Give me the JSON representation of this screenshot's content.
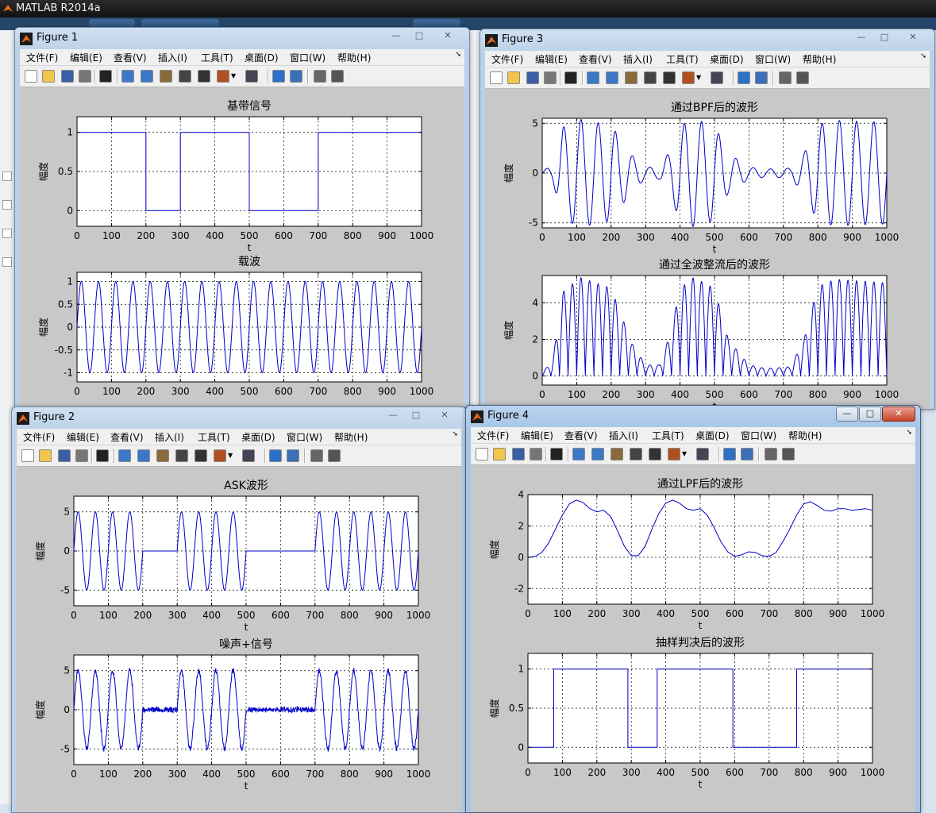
{
  "app": {
    "title": "MATLAB R2014a"
  },
  "colors": {
    "line": "#0000cc",
    "axes_bg": "#ffffff",
    "figure_bg": "#c8c8c8",
    "grid": "#000000"
  },
  "figures": [
    {
      "id": "fig1",
      "title": "Figure 1",
      "win_buttons": [
        "—",
        "□",
        "✕"
      ],
      "menu": [
        "文件(F)",
        "编辑(E)",
        "查看(V)",
        "插入(I)",
        "工具(T)",
        "桌面(D)",
        "窗口(W)",
        "帮助(H)"
      ]
    },
    {
      "id": "fig3",
      "title": "Figure 3",
      "win_buttons": [
        "—",
        "□",
        "✕"
      ],
      "menu": [
        "文件(F)",
        "编辑(E)",
        "查看(V)",
        "插入(I)",
        "工具(T)",
        "桌面(D)",
        "窗口(W)",
        "帮助(H)"
      ]
    },
    {
      "id": "fig2",
      "title": "Figure 2",
      "win_buttons": [
        "—",
        "□",
        "✕"
      ],
      "menu": [
        "文件(F)",
        "编辑(E)",
        "查看(V)",
        "插入(I)",
        "工具(T)",
        "桌面(D)",
        "窗口(W)",
        "帮助(H)"
      ]
    },
    {
      "id": "fig4",
      "title": "Figure 4",
      "win_buttons": [
        "—",
        "□",
        "✕"
      ],
      "menu": [
        "文件(F)",
        "编辑(E)",
        "查看(V)",
        "插入(I)",
        "工具(T)",
        "桌面(D)",
        "窗口(W)",
        "帮助(H)"
      ]
    }
  ],
  "toolbar_icons": [
    "new-file-icon",
    "open-folder-icon",
    "save-icon",
    "print-icon",
    "pointer-icon",
    "zoom-in-icon",
    "zoom-out-icon",
    "pan-hand-icon",
    "rotate-3d-icon",
    "data-cursor-icon",
    "brush-icon",
    "brush-dropdown-icon",
    "link-plot-icon",
    "colorbar-icon",
    "legend-icon",
    "hide-plot-tools-icon",
    "show-plot-tools-icon"
  ],
  "chart_data": [
    {
      "id": "baseband",
      "type": "line",
      "title": "基带信号",
      "xlabel": "t",
      "ylabel": "幅度",
      "xlim": [
        0,
        1000
      ],
      "ylim": [
        -0.2,
        1.2
      ],
      "xticks": [
        0,
        100,
        200,
        300,
        400,
        500,
        600,
        700,
        800,
        900,
        1000
      ],
      "yticks": [
        0,
        0.5,
        1
      ],
      "ytick_labels": [
        "0",
        "0.5",
        "1"
      ],
      "grid": true,
      "x": [
        0,
        200,
        200,
        300,
        300,
        500,
        500,
        700,
        700,
        1000
      ],
      "y": [
        1,
        1,
        0,
        0,
        1,
        1,
        0,
        0,
        1,
        1
      ]
    },
    {
      "id": "carrier",
      "type": "line",
      "title": "载波",
      "xlabel": "",
      "ylabel": "幅度",
      "xlim": [
        0,
        1000
      ],
      "ylim": [
        -1.2,
        1.2
      ],
      "xticks": [
        0,
        100,
        200,
        300,
        400,
        500,
        600,
        700,
        800,
        900,
        1000
      ],
      "yticks": [
        -1,
        -0.5,
        0,
        0.5,
        1
      ],
      "ytick_labels": [
        "-1",
        "-0.5",
        "0",
        "0.5",
        "1"
      ],
      "grid": true,
      "series": [
        {
          "function": "sin",
          "amplitude": 1,
          "period": 50,
          "phase": 0
        }
      ]
    },
    {
      "id": "bpf",
      "type": "line",
      "title": "通过BPF后的波形",
      "xlabel": "t",
      "ylabel": "幅度",
      "xlim": [
        0,
        1000
      ],
      "ylim": [
        -5.5,
        5.5
      ],
      "xticks": [
        0,
        100,
        200,
        300,
        400,
        500,
        600,
        700,
        800,
        900,
        1000
      ],
      "yticks": [
        -5,
        0,
        5
      ],
      "ytick_labels": [
        "-5",
        "0",
        "5"
      ],
      "grid": true,
      "series": [
        {
          "function": "sin",
          "period": 50,
          "envelope": [
            [
              0,
              0.2
            ],
            [
              30,
              0.8
            ],
            [
              60,
              4.6
            ],
            [
              110,
              5.4
            ],
            [
              200,
              4.8
            ],
            [
              260,
              1.8
            ],
            [
              300,
              0.6
            ],
            [
              340,
              0.6
            ],
            [
              370,
              2.2
            ],
            [
              400,
              4.8
            ],
            [
              440,
              5.4
            ],
            [
              500,
              4.8
            ],
            [
              540,
              2.0
            ],
            [
              600,
              0.6
            ],
            [
              650,
              0.4
            ],
            [
              720,
              0.5
            ],
            [
              760,
              2.0
            ],
            [
              800,
              4.9
            ],
            [
              850,
              5.3
            ],
            [
              1000,
              5.1
            ]
          ]
        }
      ]
    },
    {
      "id": "rectified",
      "type": "line",
      "title": "通过全波整流后的波形",
      "xlabel": "t",
      "ylabel": "幅度",
      "xlim": [
        0,
        1000
      ],
      "ylim": [
        -0.5,
        5.5
      ],
      "xticks": [
        0,
        100,
        200,
        300,
        400,
        500,
        600,
        700,
        800,
        900,
        1000
      ],
      "yticks": [
        0,
        2,
        4
      ],
      "ytick_labels": [
        "0",
        "2",
        "4"
      ],
      "grid": true,
      "series": [
        {
          "function": "abs-sin",
          "period": 50,
          "envelope": [
            [
              0,
              0.2
            ],
            [
              30,
              0.8
            ],
            [
              60,
              4.6
            ],
            [
              110,
              5.4
            ],
            [
              200,
              4.8
            ],
            [
              260,
              1.8
            ],
            [
              300,
              0.6
            ],
            [
              340,
              0.6
            ],
            [
              370,
              2.2
            ],
            [
              400,
              4.8
            ],
            [
              440,
              5.4
            ],
            [
              500,
              4.8
            ],
            [
              540,
              2.0
            ],
            [
              600,
              0.6
            ],
            [
              650,
              0.4
            ],
            [
              720,
              0.5
            ],
            [
              760,
              2.0
            ],
            [
              800,
              4.9
            ],
            [
              850,
              5.3
            ],
            [
              1000,
              5.1
            ]
          ]
        }
      ]
    },
    {
      "id": "ask",
      "type": "line",
      "title": "ASK波形",
      "xlabel": "t",
      "ylabel": "幅度",
      "xlim": [
        0,
        1000
      ],
      "ylim": [
        -7,
        7
      ],
      "xticks": [
        0,
        100,
        200,
        300,
        400,
        500,
        600,
        700,
        800,
        900,
        1000
      ],
      "yticks": [
        -5,
        0,
        5
      ],
      "ytick_labels": [
        "-5",
        "0",
        "5"
      ],
      "grid": true,
      "series": [
        {
          "function": "sin",
          "period": 50,
          "amplitude": 5,
          "gate": [
            [
              0,
              200
            ],
            [
              300,
              500
            ],
            [
              700,
              1000
            ]
          ]
        }
      ]
    },
    {
      "id": "noisy",
      "type": "line",
      "title": "噪声+信号",
      "xlabel": "t",
      "ylabel": "幅度",
      "xlim": [
        0,
        1000
      ],
      "ylim": [
        -7,
        7
      ],
      "xticks": [
        0,
        100,
        200,
        300,
        400,
        500,
        600,
        700,
        800,
        900,
        1000
      ],
      "yticks": [
        -5,
        0,
        5
      ],
      "ytick_labels": [
        "-5",
        "0",
        "5"
      ],
      "grid": true,
      "series": [
        {
          "function": "sin",
          "period": 50,
          "amplitude": 5,
          "noise": 0.35,
          "gate": [
            [
              0,
              200
            ],
            [
              300,
              500
            ],
            [
              700,
              1000
            ]
          ]
        }
      ]
    },
    {
      "id": "lpf",
      "type": "line",
      "title": "通过LPF后的波形",
      "xlabel": "t",
      "ylabel": "幅度",
      "xlim": [
        0,
        1000
      ],
      "ylim": [
        -3,
        4
      ],
      "xticks": [
        0,
        100,
        200,
        300,
        400,
        500,
        600,
        700,
        800,
        900,
        1000
      ],
      "yticks": [
        -2,
        0,
        2,
        4
      ],
      "ytick_labels": [
        "-2",
        "0",
        "2",
        "4"
      ],
      "grid": true,
      "x": [
        0,
        20,
        40,
        60,
        80,
        100,
        120,
        140,
        160,
        180,
        200,
        220,
        240,
        260,
        280,
        300,
        320,
        340,
        360,
        380,
        400,
        420,
        440,
        460,
        480,
        500,
        520,
        540,
        560,
        580,
        600,
        620,
        640,
        660,
        680,
        700,
        720,
        740,
        760,
        780,
        800,
        820,
        840,
        860,
        880,
        900,
        920,
        940,
        960,
        980,
        1000
      ],
      "y": [
        0,
        0.05,
        0.3,
        0.9,
        1.8,
        2.7,
        3.4,
        3.65,
        3.5,
        3.1,
        2.9,
        3.0,
        2.6,
        1.7,
        0.7,
        0.1,
        0.1,
        0.7,
        1.8,
        2.8,
        3.45,
        3.65,
        3.45,
        3.1,
        3.0,
        3.1,
        2.7,
        1.9,
        1.0,
        0.35,
        0.05,
        0.15,
        0.35,
        0.3,
        0.1,
        0.05,
        0.3,
        1.0,
        1.8,
        2.7,
        3.4,
        3.55,
        3.3,
        3.0,
        2.95,
        3.1,
        3.1,
        3.0,
        3.05,
        3.1,
        3.0
      ]
    },
    {
      "id": "decision",
      "type": "line",
      "title": "抽样判决后的波形",
      "xlabel": "t",
      "ylabel": "幅度",
      "xlim": [
        0,
        1000
      ],
      "ylim": [
        -0.2,
        1.2
      ],
      "xticks": [
        0,
        100,
        200,
        300,
        400,
        500,
        600,
        700,
        800,
        900,
        1000
      ],
      "yticks": [
        0,
        0.5,
        1
      ],
      "ytick_labels": [
        "0",
        "0.5",
        "1"
      ],
      "grid": true,
      "x": [
        0,
        75,
        75,
        290,
        290,
        375,
        375,
        595,
        595,
        780,
        780,
        1000
      ],
      "y": [
        0,
        0,
        1,
        1,
        0,
        0,
        1,
        1,
        0,
        0,
        1,
        1
      ]
    }
  ]
}
